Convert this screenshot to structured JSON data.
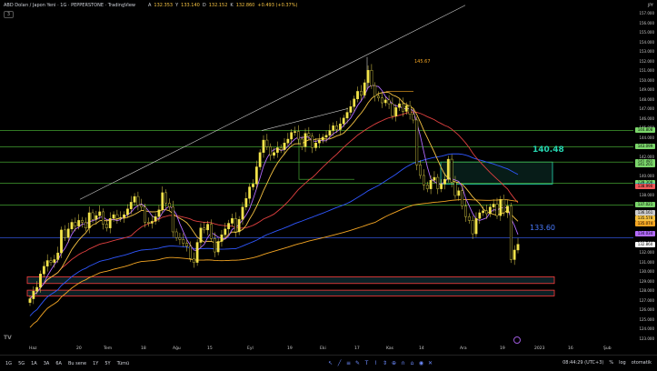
{
  "header": {
    "title": "ABD Doları / Japon Yeni · 1G · PEPPERSTONE · TradingView",
    "ohlc": [
      {
        "k": "A",
        "v": "132.353"
      },
      {
        "k": "Y",
        "v": "133.140"
      },
      {
        "k": "D",
        "v": "132.152"
      },
      {
        "k": "K",
        "v": "132.860"
      },
      {
        "k": "",
        "v": "+0.493 (+0.37%)"
      }
    ],
    "collapse_label": "3"
  },
  "currency_label": "JPY",
  "price_axis_ticks": [
    "157.000",
    "156.000",
    "155.000",
    "154.000",
    "153.000",
    "152.000",
    "151.000",
    "150.000",
    "149.000",
    "148.000",
    "147.000",
    "146.000",
    "145.000",
    "144.000",
    "143.000",
    "142.000",
    "141.000",
    "140.000",
    "139.000",
    "138.000",
    "137.000",
    "136.000",
    "135.000",
    "134.000",
    "133.000",
    "132.000",
    "131.000",
    "130.000",
    "129.000",
    "128.000",
    "127.000",
    "126.000",
    "125.000",
    "124.000",
    "123.000"
  ],
  "price_tags": [
    {
      "text": "144.808",
      "price": 144.808,
      "color": "#7bd66b"
    },
    {
      "text": "143.099",
      "price": 143.099,
      "color": "#7bd66b"
    },
    {
      "text": "141.481",
      "price": 141.481,
      "color": "#7bd66b"
    },
    {
      "text": "141.201",
      "price": 141.201,
      "color": "#7bd66b"
    },
    {
      "text": "139.308",
      "price": 139.308,
      "color": "#7bd66b"
    },
    {
      "text": "139.082",
      "price": 139.082,
      "color": "#2ec4b6"
    },
    {
      "text": "138.990",
      "price": 138.99,
      "color": "#f05a5a"
    },
    {
      "text": "137.021",
      "price": 137.021,
      "color": "#7bd66b"
    },
    {
      "text": "136.161",
      "price": 136.161,
      "color": "#cccccc"
    },
    {
      "text": "135.578",
      "price": 135.578,
      "color": "#f5c242"
    },
    {
      "text": "135.074",
      "price": 135.074,
      "color": "#f5a623"
    },
    {
      "text": "134.034",
      "price": 134.034,
      "color": "#b36bff"
    },
    {
      "text": "132.860",
      "price": 132.86,
      "color": "#ffffff"
    }
  ],
  "date_axis": [
    "Haz",
    "20",
    "Tem",
    "18",
    "Ağu",
    "15",
    "Eyl",
    "19",
    "Eki",
    "17",
    "Kas",
    "14",
    "Ara",
    "19",
    "2023",
    "16",
    "Şub"
  ],
  "annotations": {
    "level_140": "140.48",
    "level_133": "133.60",
    "level_145": "145.67"
  },
  "timeframes": [
    "1G",
    "5G",
    "1A",
    "3A",
    "6A",
    "Bu sene",
    "1Y",
    "5Y",
    "Tümü"
  ],
  "status": {
    "time": "08:44:29 (UTC+3)",
    "pct": "%",
    "log": "log",
    "auto": "otomatik"
  },
  "chart_data": {
    "type": "candlestick",
    "instrument": "ABD Doları / Japon Yeni",
    "interval": "1G",
    "ylim": [
      122.5,
      157.5
    ],
    "horizontal_levels": [
      144.8,
      143.1,
      141.5,
      139.3,
      137.0,
      133.6
    ],
    "zones": [
      {
        "top": 141.5,
        "bottom": 139.2
      },
      {
        "top": 129.5,
        "bottom": 128.8
      },
      {
        "top": 128.1,
        "bottom": 127.5
      }
    ],
    "close_series": [
      127.2,
      128.0,
      128.4,
      129.8,
      130.6,
      131.2,
      131.0,
      131.3,
      132.0,
      134.4,
      133.6,
      134.5,
      135.2,
      134.8,
      135.4,
      135.2,
      134.6,
      136.2,
      135.5,
      135.9,
      136.3,
      135.0,
      134.6,
      135.6,
      136.0,
      135.6,
      135.7,
      136.0,
      136.6,
      137.3,
      137.9,
      137.0,
      136.8,
      135.2,
      135.1,
      135.3,
      135.8,
      136.5,
      138.3,
      137.2,
      136.8,
      134.2,
      133.6,
      133.4,
      133.0,
      132.7,
      131.4,
      131.0,
      133.1,
      134.6,
      134.4,
      135.0,
      133.5,
      132.1,
      133.2,
      133.9,
      134.5,
      135.1,
      135.6,
      134.2,
      135.5,
      136.8,
      137.7,
      138.9,
      139.2,
      141.0,
      142.5,
      143.8,
      143.1,
      142.2,
      142.5,
      143.0,
      142.8,
      143.5,
      143.9,
      144.6,
      144.7,
      143.9,
      143.1,
      144.5,
      144.2,
      143.0,
      143.5,
      143.8,
      144.1,
      144.3,
      144.8,
      145.3,
      144.9,
      145.5,
      146.1,
      146.7,
      147.3,
      148.1,
      148.9,
      148.5,
      149.8,
      151.1,
      149.5,
      148.4,
      148.2,
      147.7,
      148.0,
      147.6,
      146.3,
      147.2,
      147.6,
      146.8,
      147.4,
      146.5,
      145.9,
      141.2,
      140.1,
      139.1,
      138.7,
      139.6,
      139.9,
      138.7,
      139.2,
      139.7,
      141.8,
      139.4,
      138.0,
      138.5,
      136.9,
      135.8,
      135.4,
      134.0,
      135.6,
      136.2,
      136.4,
      136.1,
      136.8,
      137.1,
      135.9,
      137.6,
      136.2,
      136.9,
      131.3,
      132.3,
      132.9
    ],
    "moving_averages": [
      {
        "color": "#2f57ff",
        "trend": "up-then-flat"
      },
      {
        "color": "#e04040",
        "trend": "up-then-down"
      },
      {
        "color": "#f5a623",
        "trend": "up"
      },
      {
        "color": "#f5c242",
        "trend": "fast"
      },
      {
        "color": "#b36bff",
        "trend": "fast"
      }
    ]
  }
}
